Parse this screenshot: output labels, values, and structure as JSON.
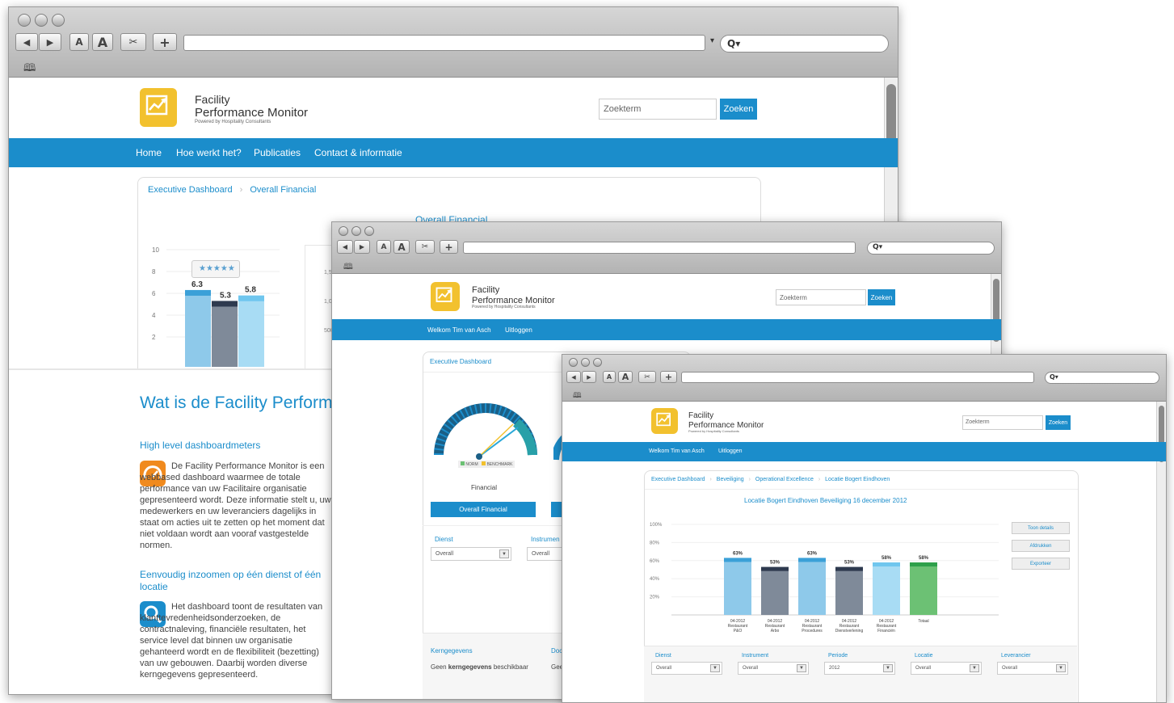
{
  "browser": {
    "zoom_small": "A",
    "zoom_large": "A",
    "add": "+",
    "search_glyph": "Q▾",
    "bookmarks_glyph": "🕮"
  },
  "site": {
    "brand_line1": "Facility",
    "brand_line2": "Performance Monitor",
    "brand_tagline": "Powered by Hospitality Consultants",
    "search_placeholder": "Zoekterm",
    "search_button": "Zoeken"
  },
  "win1": {
    "nav": [
      "Home",
      "Hoe werkt het?",
      "Publicaties",
      "Contact & informatie"
    ],
    "breadcrumb": [
      "Executive Dashboard",
      "Overall Financial"
    ],
    "chart_title": "Overall Financial",
    "rating": "★★★★★",
    "heading": "Wat is de Facility Performa",
    "section1_title": "High level dashboardmeters",
    "section1_text": "De Facility Performance Monitor is een webbased dashboard waarmee de totale performance van uw Facilitaire organisatie gepresenteerd wordt. Deze informatie stelt u, uw medewerkers en uw leveranciers dagelijks in staat om acties uit te zetten op het moment dat niet voldaan wordt aan vooraf vastgestelde normen.",
    "section2_title": "Eenvoudig inzoomen op één dienst of één locatie",
    "section2_text": "Het dashboard toont de resultaten van klanttevredenheidsonderzoeken, de contractnaleving, financiële resultaten, het service level dat binnen uw organisatie gehanteerd wordt en de flexibiliteit (bezetting) van uw gebouwen. Daarbij worden diverse kerngegevens gepresenteerd."
  },
  "win2": {
    "nav": [
      "Welkom Tim van Asch",
      "Uitloggen"
    ],
    "breadcrumb": [
      "Executive Dashboard"
    ],
    "legend": [
      "NORM",
      "BENCHMARK"
    ],
    "gauge_label": "Financial",
    "gauge_button": "Overall Financial",
    "filter1_label": "Dienst",
    "filter1_value": "Overall",
    "filter2_label": "Instrumen",
    "filter2_value": "Overall",
    "kern_title": "Kerngegevens",
    "kern_text_prefix": "Geen ",
    "kern_text_bold": "kerngegevens",
    "kern_text_suffix": " beschikbaar",
    "doc_title": "Doc",
    "doc_text": "Gee"
  },
  "win3": {
    "nav": [
      "Welkom Tim van Asch",
      "Uitloggen"
    ],
    "breadcrumb": [
      "Executive Dashboard",
      "Beveiliging",
      "Operational Excellence",
      "Locatie Bogert Eindhoven"
    ],
    "chart_title": "Locatie Bogert Eindhoven Beveiliging 16 december 2012",
    "buttons": [
      "Toon details",
      "Afdrukken",
      "Exporteer"
    ],
    "filters": [
      {
        "label": "Dienst",
        "value": "Overall"
      },
      {
        "label": "Instrument",
        "value": "Overall"
      },
      {
        "label": "Periode",
        "value": "2012"
      },
      {
        "label": "Locatie",
        "value": "Overall"
      },
      {
        "label": "Leverancier",
        "value": "Overall"
      }
    ]
  },
  "chart_data": [
    {
      "type": "bar",
      "title": "Overall Financial",
      "categories": [
        "",
        "",
        ""
      ],
      "values": [
        6.3,
        5.3,
        5.8
      ],
      "value_labels": [
        "6.3",
        "5.3",
        "5.8"
      ],
      "yticks": [
        "10",
        "8",
        "6",
        "4",
        "2"
      ],
      "ylim": [
        0,
        10
      ],
      "colors": [
        "#8ec9ea",
        "#7f8a99",
        "#a8dcf4"
      ],
      "top_colors": [
        "#3ba0d8",
        "#2e3a4f",
        "#6fc6ee"
      ],
      "secondary_ticks": [
        "1,500",
        "1,000",
        "500"
      ]
    },
    {
      "type": "bar",
      "title": "Locatie Bogert Eindhoven Beveiliging 16 december 2012",
      "categories": [
        [
          "04-2012",
          "Restaurant",
          "P&O"
        ],
        [
          "04-2012",
          "Restaurant",
          "Arbo"
        ],
        [
          "04-2012",
          "Restaurant",
          "Procedures"
        ],
        [
          "04-2012",
          "Restaurant",
          "Dienstverlening"
        ],
        [
          "04-2012",
          "Restaurant",
          "Financiën"
        ],
        [
          "Totaal"
        ]
      ],
      "values": [
        63,
        53,
        63,
        53,
        58,
        58
      ],
      "value_labels": [
        "63%",
        "53%",
        "63%",
        "53%",
        "58%",
        "58%"
      ],
      "yticks": [
        "100%",
        "80%",
        "60%",
        "40%",
        "20%"
      ],
      "ylim": [
        0,
        100
      ],
      "colors": [
        "#8ec9ea",
        "#7f8a99",
        "#8ec9ea",
        "#7f8a99",
        "#a8dcf4",
        "#6cc174"
      ],
      "top_colors": [
        "#3ba0d8",
        "#2e3a4f",
        "#3ba0d8",
        "#2e3a4f",
        "#6fc6ee",
        "#2ea04a"
      ]
    }
  ]
}
